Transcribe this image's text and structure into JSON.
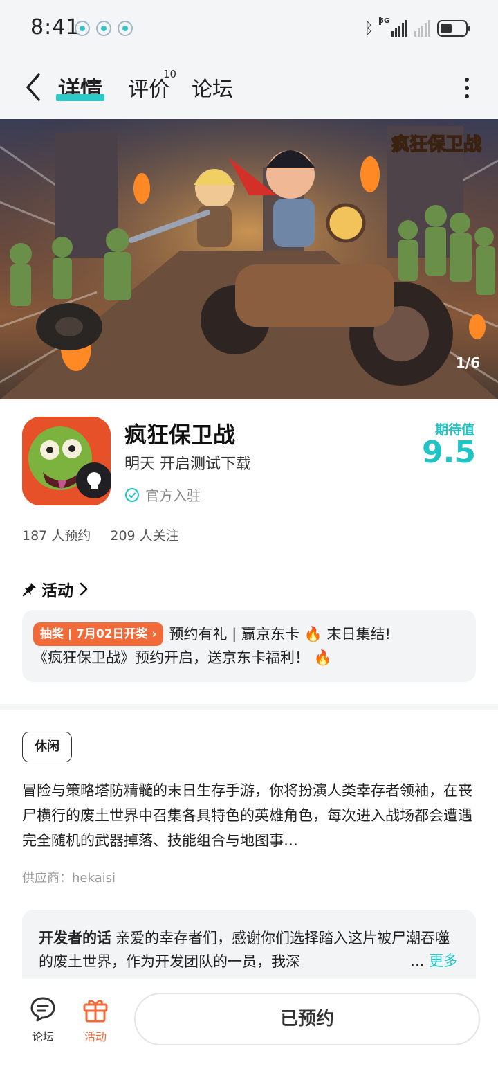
{
  "status_bar": {
    "time": "8:41",
    "network": "5G"
  },
  "nav": {
    "tabs": [
      {
        "label": "详情"
      },
      {
        "label": "评价",
        "badge": "10"
      },
      {
        "label": "论坛"
      }
    ]
  },
  "banner": {
    "logo_text": "疯狂保卫战",
    "counter": "1/6"
  },
  "app": {
    "name": "疯狂保卫战",
    "status": "明天 开启测试下载",
    "official": "官方入驻",
    "expect_label": "期待值",
    "expect_value": "9.5",
    "reservations": "187 人预约",
    "followers": "209 人关注"
  },
  "activity": {
    "title": "活动",
    "badge": "抽奖 | 7月02日开奖",
    "line1": "预约有礼 | 赢京东卡",
    "line1_tail": "末日集结!",
    "line2": "《疯狂保卫战》预约开启，送京东卡福利！"
  },
  "details": {
    "tag": "休闲",
    "description": "冒险与策略塔防精髓的末日生存手游，你将扮演人类幸存者领袖，在丧尸横行的废土世界中召集各具特色的英雄角色，每次进入战场都会遭遇完全随机的武器掉落、技能组合与地图事…",
    "supplier": "供应商：hekaisi"
  },
  "developer": {
    "label": "开发者的话",
    "text": "亲爱的幸存者们，感谢你们选择踏入这片被尸潮吞噬的废土世界，作为开发团队的一员，我深",
    "ellipsis": "...",
    "more": "更多"
  },
  "bottom_bar": {
    "forum": "论坛",
    "activity": "活动",
    "reserve_button": "已预约"
  },
  "colors": {
    "accent": "#21c4c4",
    "orange": "#f16b3a"
  }
}
